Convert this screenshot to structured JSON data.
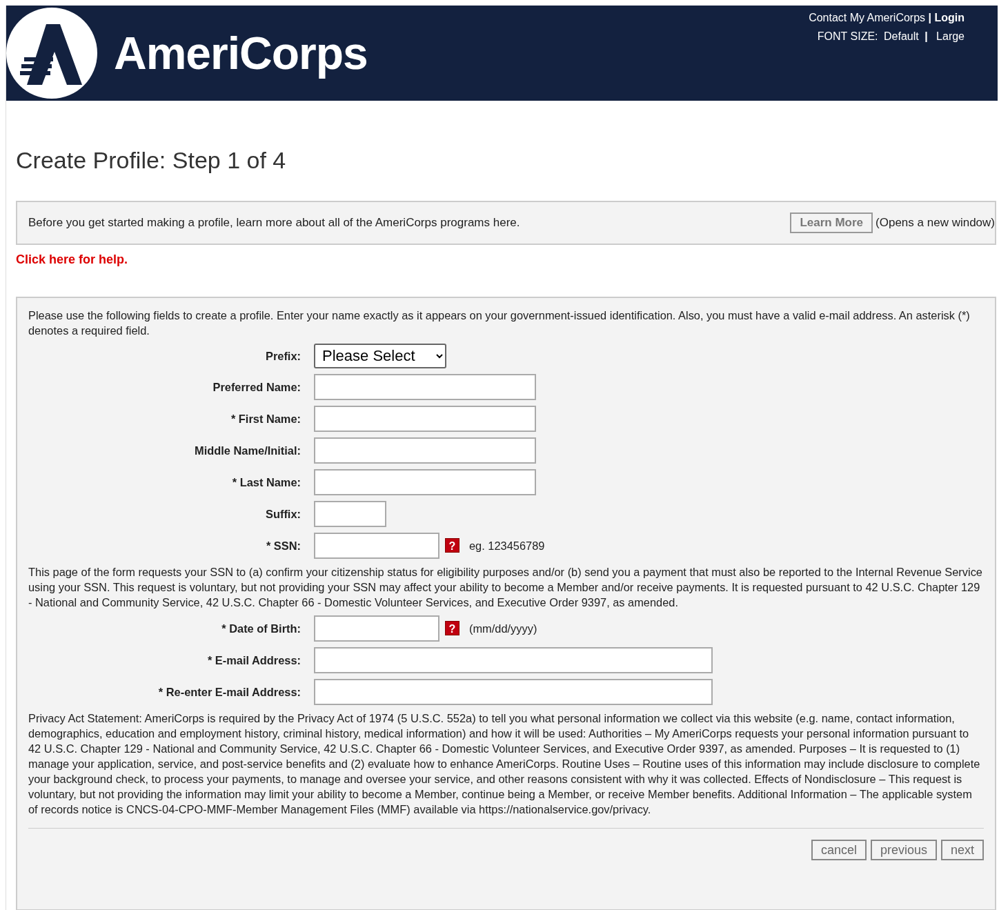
{
  "header": {
    "logo_text": "AmeriCorps",
    "contact_link": "Contact My AmeriCorps",
    "separator": "|",
    "login_link": "Login",
    "font_size_label": "FONT SIZE:",
    "font_sizes": [
      {
        "label": "Default"
      },
      {
        "label": "Large"
      }
    ]
  },
  "title": "Create Profile: Step 1 of 4",
  "info": {
    "text": "Before you get started making a profile, learn more about all of the AmeriCorps programs here.",
    "button": "Learn More",
    "note": "(Opens a new window)"
  },
  "help_link": "Click here for help.",
  "form": {
    "intro": "Please use the following fields to create a profile. Enter your name exactly as it appears on your government-issued identification. Also, you must have a valid e-mail address. An asterisk (*) denotes a required field.",
    "fields": [
      {
        "label": "Prefix:",
        "kind": "select",
        "value": "Please Select"
      },
      {
        "label": "Preferred Name:",
        "kind": "name"
      },
      {
        "label": "* First Name:",
        "kind": "name"
      },
      {
        "label": "Middle Name/Initial:",
        "kind": "name"
      },
      {
        "label": "* Last Name:",
        "kind": "name"
      },
      {
        "label": "Suffix:",
        "kind": "suffix"
      },
      {
        "label": "* SSN:",
        "kind": "number",
        "help_icon": "?",
        "hint": "eg. 123456789"
      },
      {
        "kind": "note",
        "text": "This page of the form requests your SSN to (a) confirm your citizenship status for eligibility purposes and/or (b) send you a payment that must also be reported to the Internal Revenue Service using your SSN. This request is voluntary, but not providing your SSN may affect your ability to become a Member and/or receive payments. It is requested pursuant to 42 U.S.C. Chapter 129 - National and Community Service, 42 U.S.C. Chapter 66 - Domestic Volunteer Services, and Executive Order 9397, as amended."
      },
      {
        "label": "* Date of Birth:",
        "kind": "number",
        "help_icon": "?",
        "hint": "(mm/dd/yyyy)"
      },
      {
        "label": "* E-mail Address:",
        "kind": "email"
      },
      {
        "label": "* Re-enter E-mail Address:",
        "kind": "email"
      },
      {
        "kind": "note",
        "text": "Privacy Act Statement: AmeriCorps is required by the Privacy Act of 1974 (5 U.S.C. 552a) to tell you what personal information we collect via this website (e.g. name, contact information, demographics, education and employment history, criminal history, medical information) and how it will be used: Authorities – My AmeriCorps requests your personal information pursuant to 42 U.S.C. Chapter 129 - National and Community Service, 42 U.S.C. Chapter 66 - Domestic Volunteer Services, and Executive Order 9397, as amended. Purposes – It is requested to (1) manage your application, service, and post-service benefits and (2) evaluate how to enhance AmeriCorps. Routine Uses – Routine uses of this information may include disclosure to complete your background check, to process your payments, to manage and oversee your service, and other reasons consistent with why it was collected. Effects of Nondisclosure – This request is voluntary, but not providing the information may limit your ability to become a Member, continue being a Member, or receive Member benefits. Additional Information – The applicable system of records notice is CNCS-04-CPO-MMF-Member Management Files (MMF) available via https://nationalservice.gov/privacy."
      }
    ],
    "buttons": [
      "cancel",
      "previous",
      "next"
    ]
  }
}
